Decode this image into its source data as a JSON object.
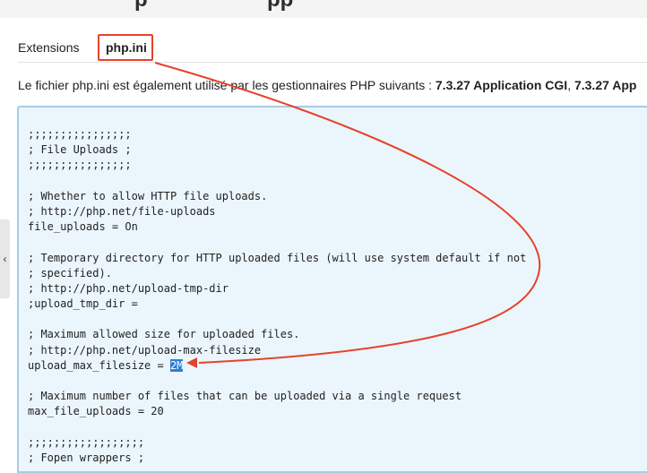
{
  "header": {
    "title_fragment": "p                    pp"
  },
  "tabs": [
    {
      "label": "Extensions"
    },
    {
      "label": "php.ini"
    }
  ],
  "description": {
    "prefix": "Le fichier php.ini est également utilisé par les gestionnaires PHP suivants : ",
    "handler1": "7.3.27 Application CGI",
    "separator": ", ",
    "handler2": "7.3.27 App"
  },
  "editor": {
    "lines": [
      ";;;;;;;;;;;;;;;;",
      "; File Uploads ;",
      ";;;;;;;;;;;;;;;;",
      "",
      "; Whether to allow HTTP file uploads.",
      "; http://php.net/file-uploads",
      "file_uploads = On",
      "",
      "; Temporary directory for HTTP uploaded files (will use system default if not",
      "; specified).",
      "; http://php.net/upload-tmp-dir",
      ";upload_tmp_dir =",
      "",
      "; Maximum allowed size for uploaded files.",
      "; http://php.net/upload-max-filesize"
    ],
    "highlight_line": {
      "prefix": "upload_max_filesize = ",
      "selected": "2M"
    },
    "lines_after": [
      "",
      "; Maximum number of files that can be uploaded via a single request",
      "max_file_uploads = 20",
      "",
      ";;;;;;;;;;;;;;;;;;",
      "; Fopen wrappers ;"
    ]
  },
  "side_handle": {
    "glyph": "‹",
    "icon": "chevron-left-icon"
  },
  "colors": {
    "annotation": "#e5432c",
    "selection": "#2f7fd6",
    "editor_bg": "#ebf6fc",
    "editor_border": "#a6cbe6"
  }
}
